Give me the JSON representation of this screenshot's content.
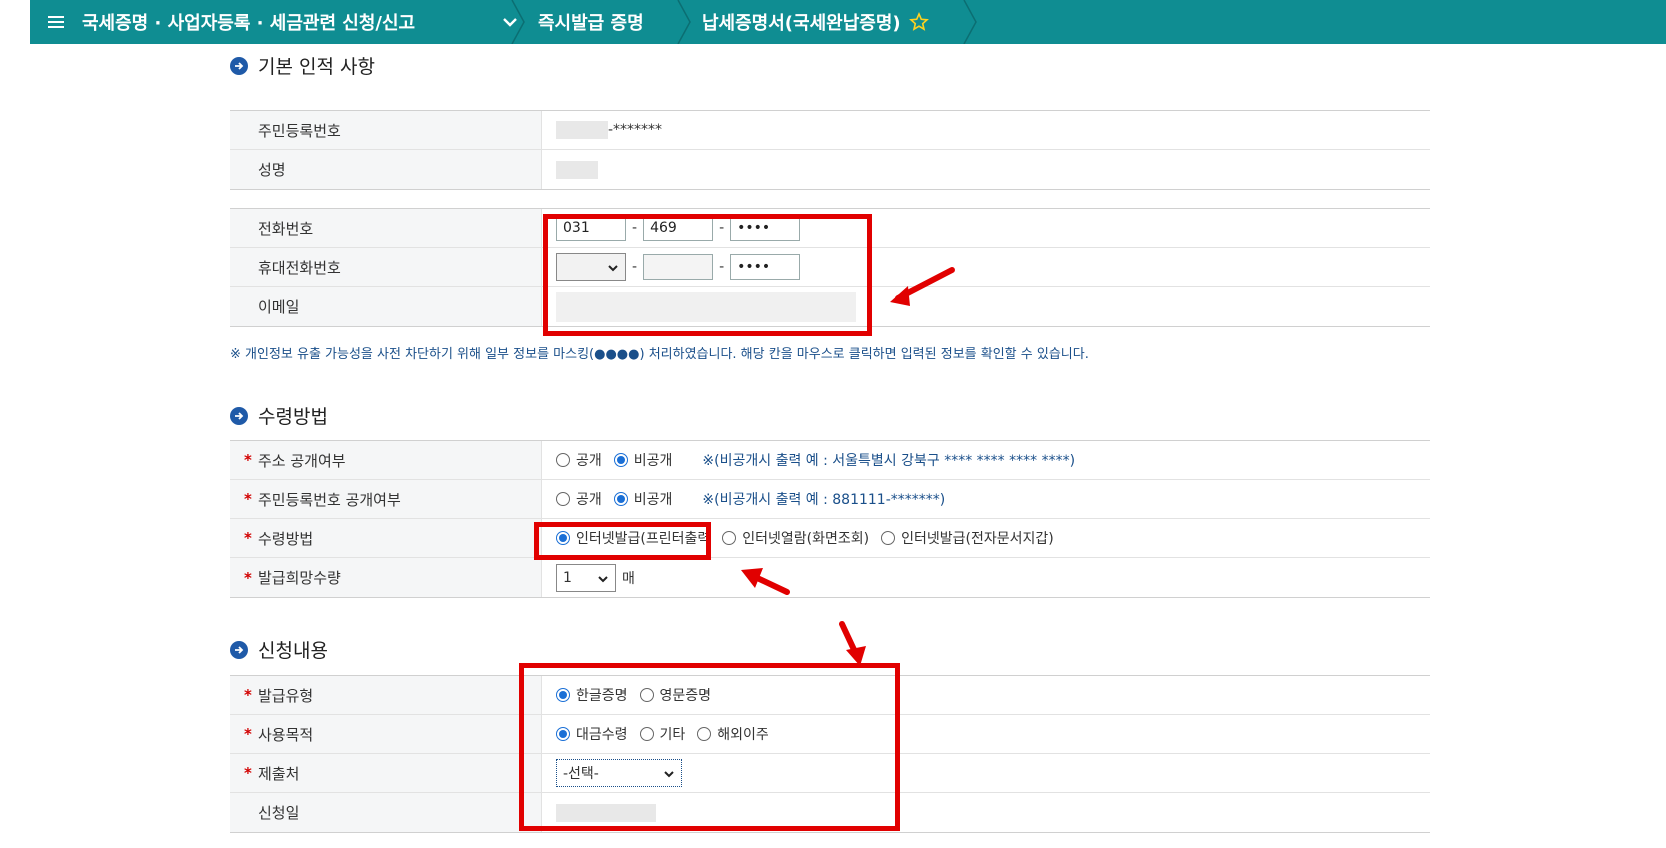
{
  "nav": {
    "menu_label": "국세증명 · 사업자등록 · 세금관련 신청/신고",
    "crumb1": "즉시발급 증명",
    "crumb2": "납세증명서(국세완납증명)"
  },
  "basic": {
    "title": "기본 인적 사항",
    "rrn_label": "주민등록번호",
    "rrn_suffix": "-*******",
    "name_label": "성명",
    "phone_label": "전화번호",
    "phone1": "031",
    "phone2": "469",
    "phone3": "••••",
    "mobile_label": "휴대전화번호",
    "mobile3": "••••",
    "email_label": "이메일"
  },
  "notice": "※ 개인정보 유출 가능성을 사전 차단하기 위해 일부 정보를 마스킹(●●●●) 처리하였습니다. 해당 칸을 마우스로 클릭하면 입력된 정보를 확인할 수 있습니다.",
  "receive": {
    "title": "수령방법",
    "addr_label": "주소 공개여부",
    "rrn_label": "주민등록번호 공개여부",
    "method_label": "수령방법",
    "qty_label": "발급희망수량",
    "public": "공개",
    "private": "비공개",
    "addr_note": "※(비공개시 출력 예 : 서울특별시 강북구 **** **** **** ****)",
    "rrn_note": "※(비공개시 출력 예 : 881111-*******)",
    "method_opt1": "인터넷발급(프린터출력",
    "method_opt2": "인터넷열람(화면조회)",
    "method_opt3": "인터넷발급(전자문서지갑)",
    "qty_value": "1",
    "qty_unit": "매"
  },
  "apply": {
    "title": "신청내용",
    "type_label": "발급유형",
    "type_opt1": "한글증명",
    "type_opt2": "영문증명",
    "purpose_label": "사용목적",
    "purpose_opt1": "대금수령",
    "purpose_opt2": "기타",
    "purpose_opt3": "해외이주",
    "submit_label": "제출처",
    "submit_value": "-선택-",
    "date_label": "신청일"
  },
  "colors": {
    "topbar": "#0f8d92",
    "highlight": "#e10000",
    "radio_on": "#1a6fd6"
  }
}
